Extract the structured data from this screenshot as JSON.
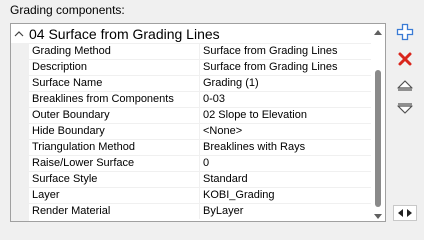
{
  "heading": "Grading components:",
  "group": {
    "title": "04 Surface from Grading Lines",
    "expanded": true
  },
  "properties": [
    {
      "name": "Grading Method",
      "value": "Surface from Grading Lines"
    },
    {
      "name": "Description",
      "value": "Surface from Grading Lines"
    },
    {
      "name": "Surface Name",
      "value": "Grading (1)"
    },
    {
      "name": "Breaklines from Components",
      "value": "0-03"
    },
    {
      "name": "Outer Boundary",
      "value": "02 Slope to Elevation"
    },
    {
      "name": "Hide Boundary",
      "value": "<None>"
    },
    {
      "name": "Triangulation Method",
      "value": "Breaklines with Rays"
    },
    {
      "name": "Raise/Lower Surface",
      "value": "0"
    },
    {
      "name": "Surface Style",
      "value": "Standard"
    },
    {
      "name": "Layer",
      "value": "KOBI_Grading"
    },
    {
      "name": "Render Material",
      "value": "ByLayer"
    }
  ],
  "icons": {
    "collapse": "chevron-up-icon",
    "add": "add-component-icon",
    "delete": "delete-icon",
    "move_up": "move-up-icon",
    "move_down": "move-down-icon",
    "resize": "resize-horizontal-icon"
  },
  "colors": {
    "add": "#3a7bd5",
    "delete": "#d9261c",
    "scroll_thumb": "#8a8a8a"
  }
}
